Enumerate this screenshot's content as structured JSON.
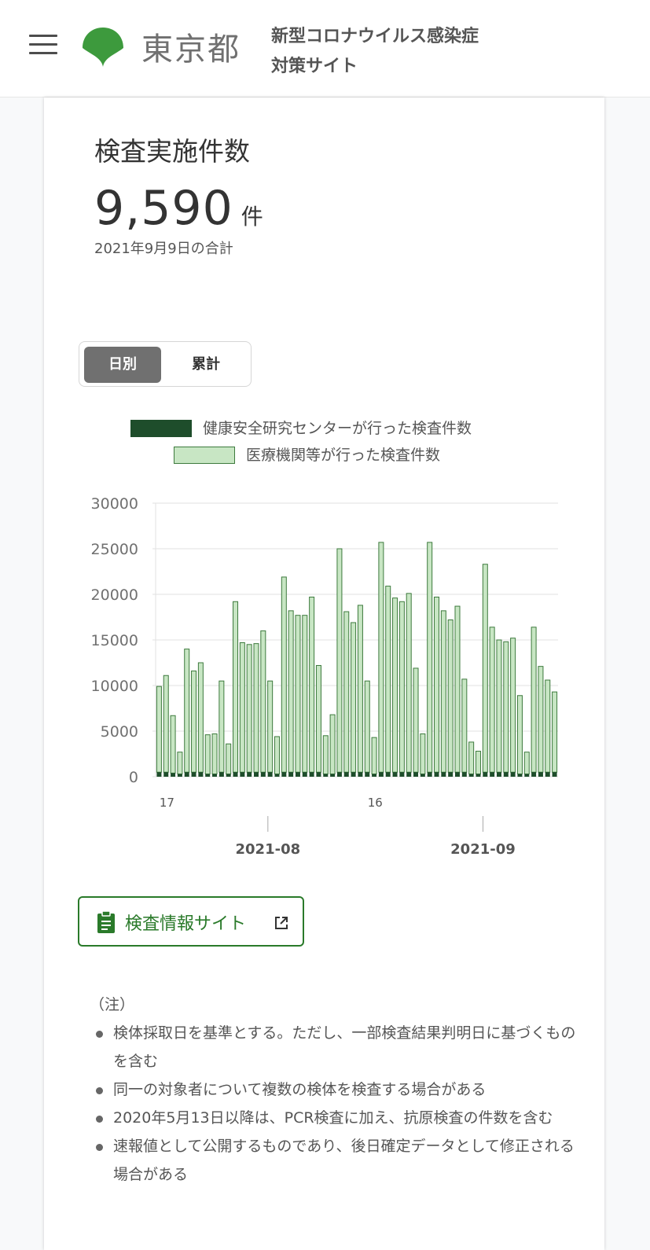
{
  "header": {
    "logo_text": "東京都",
    "site_title_line1": "新型コロナウイルス感染症",
    "site_title_line2": "対策サイト"
  },
  "card": {
    "title": "検査実施件数",
    "total_value": "9,590",
    "total_unit": "件",
    "total_note": "2021年9月9日の合計",
    "toggle": {
      "daily": "日別",
      "cumulative": "累計",
      "selected": "daily"
    },
    "legend": [
      {
        "label": "健康安全研究センターが行った検査件数",
        "color": "#1e4d2b"
      },
      {
        "label": "医療機関等が行った検査件数",
        "color": "#c8e6c4"
      }
    ],
    "link": {
      "label": "検査情報サイト",
      "icon": "clipboard-icon",
      "trailing_icon": "open-in-new-icon"
    },
    "notes": {
      "heading": "（注）",
      "items": [
        "検体採取日を基準とする。ただし、一部検査結果判明日に基づくものを含む",
        "同一の対象者について複数の検体を検査する場合がある",
        "2020年5月13日以降は、PCR検査に加え、抗原検査の件数を含む",
        "速報値として公開するものであり、後日確定データとして修正される場合がある"
      ]
    }
  },
  "chart_data": {
    "type": "bar",
    "stacked": true,
    "y_ticks": [
      "30000",
      "25000",
      "20000",
      "15000",
      "10000",
      "5000",
      "0"
    ],
    "ylim": [
      0,
      30000
    ],
    "grid": true,
    "x_day_labels": [
      {
        "label": "17",
        "index": 0
      },
      {
        "label": "16",
        "index": 30
      }
    ],
    "x_month_labels": [
      {
        "label": "2021-08",
        "index": 15
      },
      {
        "label": "2021-09",
        "index": 46
      }
    ],
    "colors": {
      "center": "#1e4d2b",
      "medical": "#c8e6c4",
      "medical_border": "#3d7a3d"
    },
    "series": [
      {
        "name": "健康安全研究センターが行った検査件数",
        "values": [
          500,
          500,
          400,
          300,
          500,
          500,
          500,
          300,
          300,
          500,
          300,
          500,
          500,
          500,
          500,
          500,
          500,
          300,
          500,
          500,
          500,
          500,
          500,
          500,
          300,
          300,
          500,
          500,
          500,
          500,
          500,
          300,
          500,
          500,
          500,
          500,
          500,
          500,
          300,
          500,
          500,
          500,
          500,
          500,
          500,
          300,
          300,
          500,
          500,
          500,
          500,
          500,
          300,
          300,
          500,
          500,
          500,
          500
        ]
      },
      {
        "name": "医療機関等が行った検査件数",
        "values": [
          9400,
          10600,
          6300,
          2400,
          13500,
          11100,
          12000,
          4300,
          4400,
          10000,
          3300,
          18700,
          14200,
          14000,
          14100,
          15500,
          10000,
          4100,
          21400,
          17700,
          17200,
          17200,
          19200,
          11700,
          4200,
          6500,
          24500,
          17600,
          16400,
          18300,
          10000,
          4000,
          25200,
          20400,
          19100,
          18700,
          19600,
          11400,
          4400,
          25200,
          19200,
          17700,
          16700,
          18200,
          10200,
          3500,
          2500,
          22800,
          15900,
          14500,
          14300,
          14700,
          8600,
          2400,
          15900,
          11600,
          10100,
          8800
        ]
      }
    ]
  }
}
